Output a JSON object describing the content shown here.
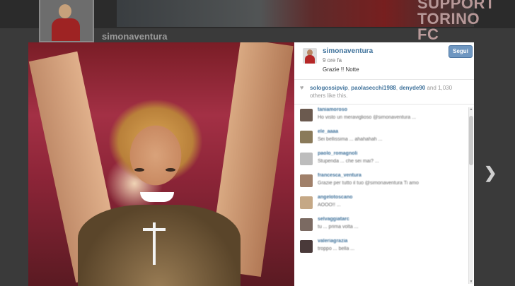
{
  "background": {
    "banner_text_line1": "SUPPORT",
    "banner_text_line2": "TORINO FC",
    "username": "simonaventura"
  },
  "post": {
    "username": "simonaventura",
    "time": "9 ore fa",
    "caption": "Grazie !! Notte",
    "follow_label": "Segui"
  },
  "likes": {
    "users": [
      "sologossipvip",
      "paolasecchi1988",
      "denyde90"
    ],
    "summary": "and 1,030 others like this."
  },
  "comments": [
    {
      "user": "taniamoroso",
      "text": "Ho visto un meraviglioso @simonaventura ..."
    },
    {
      "user": "ele_aaaa",
      "text": "Sei bellissima ... ahahahah ..."
    },
    {
      "user": "paolo_romagnoli",
      "text": "Stupenda ... che sei mai? ..."
    },
    {
      "user": "francesca_ventura",
      "text": "Grazie per tutto il tuo @simonaventura Ti amo"
    },
    {
      "user": "angelotoscano",
      "text": "AOOO!! ..."
    },
    {
      "user": "selvaggiatarc",
      "text": "tu ... prima volta ..."
    },
    {
      "user": "valeriagrazia",
      "text": "troppo ... bella ..."
    }
  ],
  "icons": {
    "heart": "heart-icon",
    "next": "chevron-right-icon"
  },
  "colors": {
    "link": "#3f729b",
    "follow_button": "#6f97c1"
  }
}
